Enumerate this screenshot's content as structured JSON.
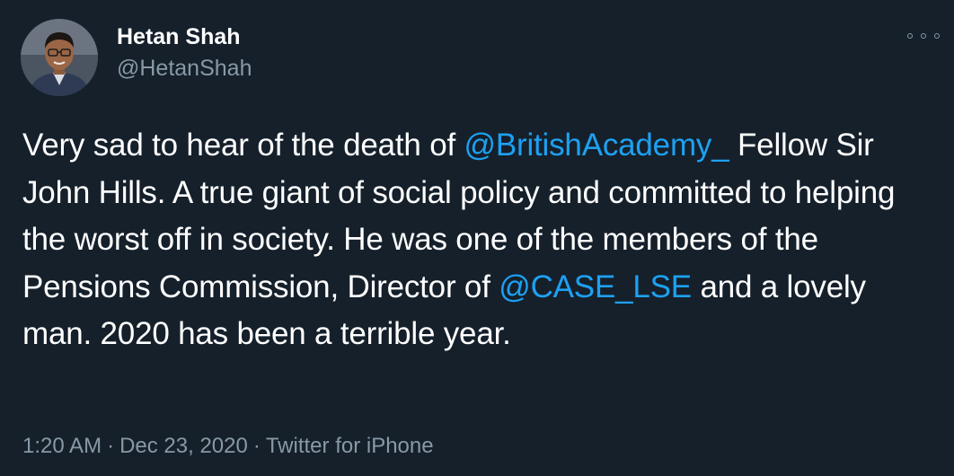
{
  "author": {
    "display_name": "Hetan Shah",
    "handle": "@HetanShah"
  },
  "tweet": {
    "text_1": "Very sad to hear of the death of ",
    "mention_1": "@BritishAcademy_",
    "text_2": " Fellow Sir John Hills. A true giant of social policy and committed to helping the worst off in society. He was one of the members of the Pensions Commission, Director of ",
    "mention_2": "@CASE_LSE",
    "text_3": " and a lovely man. 2020 has been a terrible year."
  },
  "meta": {
    "time": "1:20 AM",
    "separator": "·",
    "date": "Dec 23, 2020",
    "source": "Twitter for iPhone"
  },
  "icons": {
    "more": "more-horizontal-icon"
  },
  "colors": {
    "background": "#15202b",
    "text": "#ffffff",
    "secondary": "#8899a6",
    "mention": "#1da1f2"
  }
}
